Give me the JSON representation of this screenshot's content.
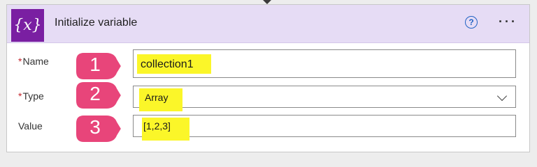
{
  "action": {
    "title": "Initialize variable",
    "icon_text": "{x}",
    "icon_name": "variable-icon",
    "icon_color": "#7a1fa2",
    "header_color": "#e6dcf5",
    "help_glyph": "?",
    "more_glyph": "···"
  },
  "form": {
    "name": {
      "required_mark": "*",
      "label": "Name",
      "value": "collection1"
    },
    "type": {
      "required_mark": "*",
      "label": "Type",
      "value": "Array"
    },
    "value": {
      "label": "Value",
      "value": "[1,2,3]"
    }
  },
  "callouts": [
    {
      "number": "1"
    },
    {
      "number": "2"
    },
    {
      "number": "3"
    }
  ],
  "colors": {
    "callout": "#e8457a",
    "highlight": "#fbf629",
    "required": "#c4262e",
    "help": "#2163c4"
  }
}
